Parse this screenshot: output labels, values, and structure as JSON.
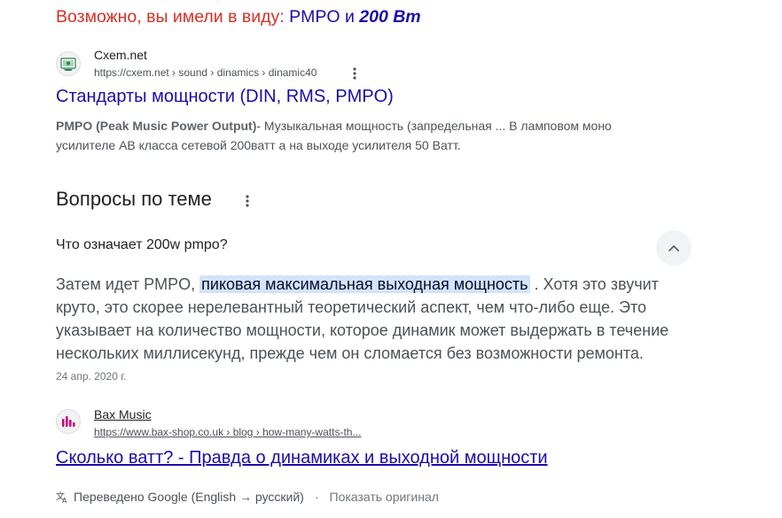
{
  "did_you_mean": {
    "lead": "Возможно, вы имели в виду:",
    "term1": "PMPO",
    "joiner": "и",
    "term2": "200 Вт"
  },
  "result1": {
    "site_name": "Cxem.net",
    "url": "https://cxem.net › sound › dinamics › dinamic40",
    "title": "Стандарты мощности (DIN, RMS, PMPO)",
    "snippet_bold": "PMPO (Peak Music Power Output)",
    "snippet_line1": "- Музыкальная мощность (запредельная ... В ламповом моно",
    "snippet_line2": "усилителе АВ класса сетевой 200ватт а на выходе усилителя 50 Ватт.",
    "favicon": "cxem-favicon",
    "menu_icon": "more-vert-icon"
  },
  "questions": {
    "heading": "Вопросы по теме",
    "menu_icon": "more-vert-icon",
    "q1": {
      "question": "Что означает 200w pmpo?",
      "toggle_icon": "chevron-up-icon",
      "answer_before": "Затем идет PMPO, ",
      "answer_highlight": "пиковая максимальная выходная мощность",
      "answer_after": " . Хотя это звучит круто, это скорее нерелевантный теоретический аспект, чем что-либо еще. Это указывает на количество мощности, которое динамик может выдержать в течение нескольких миллисекунд, прежде чем он сломается без возможности ремонта.",
      "date": "24 апр. 2020 г."
    }
  },
  "result2": {
    "site_name": "Bax Music",
    "url": "https://www.bax-shop.co.uk › blog › how-many-watts-th...",
    "title": "Сколько ватт? - Правда о динамиках и выходной мощности",
    "translated_label": "Переведено Google (English → русский)",
    "show_original": "Показать оригинал",
    "favicon": "bax-music-favicon",
    "translate_icon": "translate-icon",
    "accent": "#d1007e"
  },
  "colors": {
    "link": "#1a0dab",
    "did_you_mean_lead": "#d93025",
    "highlight": "#d3e3fd"
  }
}
